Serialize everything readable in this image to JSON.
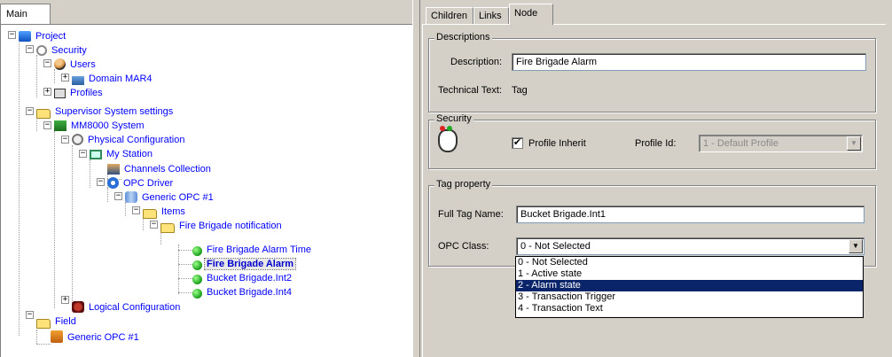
{
  "left": {
    "tab_label": "Main",
    "tree": {
      "project": "Project",
      "security": "Security",
      "users": "Users",
      "domain": "Domain MAR4",
      "profiles": "Profiles",
      "supervisor": "Supervisor System settings",
      "mm8000": "MM8000 System",
      "physical": "Physical Configuration",
      "station": "My Station",
      "channels": "Channels Collection",
      "opc_driver": "OPC Driver",
      "generic_opc": "Generic OPC #1",
      "items": "Items",
      "fire_notif": "Fire Brigade notification",
      "alarm_time": "Fire Brigade Alarm Time",
      "alarm": "Fire Brigade Alarm",
      "int2": "Bucket Brigade.Int2",
      "int4": "Bucket Brigade.Int4",
      "logical": "Logical Configuration",
      "field": "Field",
      "field_generic": "Generic OPC #1"
    }
  },
  "right": {
    "tabs": [
      "Children",
      "Links",
      "Node"
    ],
    "descriptions": {
      "title": "Descriptions",
      "desc_label": "Description:",
      "desc_value": "Fire Brigade Alarm",
      "tech_label": "Technical Text:",
      "tech_value": "Tag"
    },
    "security": {
      "title": "Security",
      "inherit_label": "Profile Inherit",
      "inherit_checked": true,
      "profile_id_label": "Profile Id:",
      "profile_id_value": "1 - Default Profile"
    },
    "tag": {
      "title": "Tag property",
      "full_tag_label": "Full Tag Name:",
      "full_tag_value": "Bucket Brigade.Int1",
      "opc_class_label": "OPC Class:",
      "opc_class_value": "0 - Not Selected",
      "opc_class_options": [
        "0 - Not Selected",
        "1 - Active state",
        "2 - Alarm state",
        "3 - Transaction Trigger",
        "4 - Transaction Text"
      ],
      "opc_class_highlighted": "2 - Alarm state"
    }
  }
}
